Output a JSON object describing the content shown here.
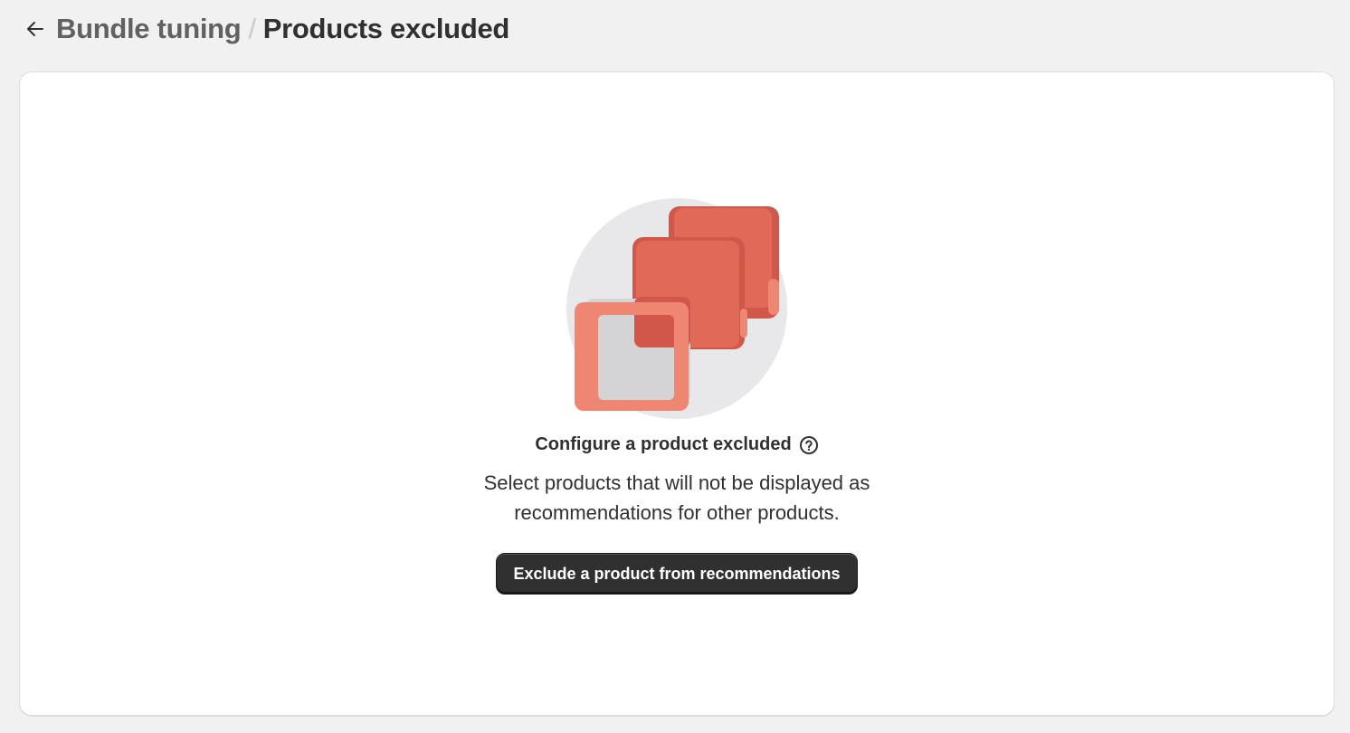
{
  "header": {
    "back_icon": "arrow-left-icon",
    "breadcrumb_parent": "Bundle tuning",
    "breadcrumb_separator": "/",
    "breadcrumb_current": "Products excluded"
  },
  "empty_state": {
    "illustration_icon": "stacked-products-icon",
    "title": "Configure a product excluded",
    "help_icon": "question-circle-icon",
    "description": "Select products that will not be displayed as recommendations for other products.",
    "button_label": "Exclude a product from recommendations"
  },
  "colors": {
    "page_background": "#f1f1f1",
    "card_background": "#ffffff",
    "button_background": "#303030",
    "illustration_red": "#e06a58",
    "illustration_salmon": "#ee8672",
    "illustration_circle": "#e8e8ea"
  }
}
